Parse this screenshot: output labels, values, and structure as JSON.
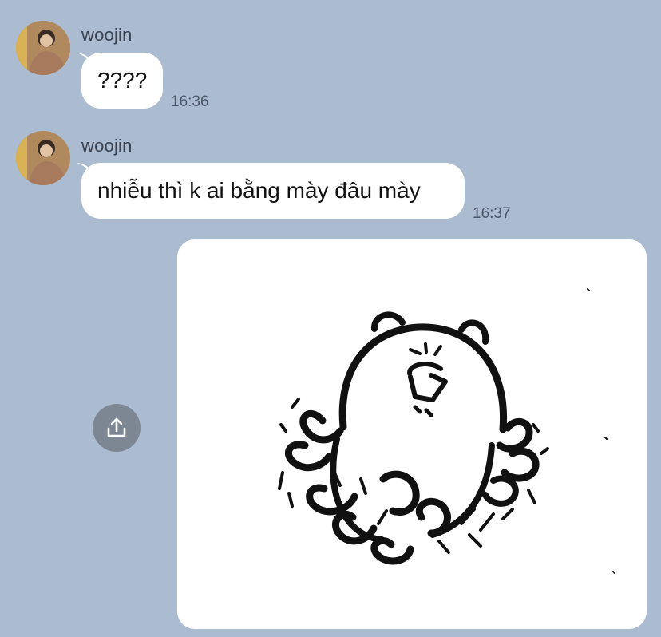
{
  "messages": [
    {
      "sender": "woojin",
      "text": "????",
      "time": "16:36"
    },
    {
      "sender": "woojin",
      "text": "nhiễu thì k ai bằng mày đâu mày",
      "time": "16:37"
    }
  ],
  "sticker": {
    "icon": "bear-sticker"
  },
  "share": {
    "icon": "share-upload-icon"
  },
  "colors": {
    "background": "#abbcd1",
    "bubble": "#ffffff",
    "share_button": "#7d8794"
  }
}
